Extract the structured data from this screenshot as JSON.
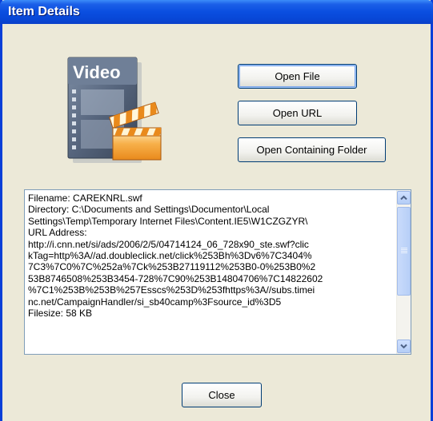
{
  "window": {
    "title": "Item Details"
  },
  "icon": {
    "label": "Video"
  },
  "buttons": {
    "open_file": "Open File",
    "open_url": "Open URL",
    "open_folder": "Open Containing Folder",
    "close": "Close"
  },
  "details": {
    "lines": [
      "Filename: CAREKNRL.swf",
      "Directory: C:\\Documents and Settings\\Documentor\\Local",
      "Settings\\Temp\\Temporary Internet Files\\Content.IE5\\W1CZGZYR\\",
      "URL Address:",
      "http://i.cnn.net/si/ads/2006/2/5/04714124_06_728x90_ste.swf?clic",
      "kTag=http%3A//ad.doubleclick.net/click%253Bh%3Dv6%7C3404%",
      "7C3%7C0%7C%252a%7Ck%253B27119112%253B0-0%253B0%2",
      "53B8746508%253B3454-728%7C90%253B14804706%7C14822602",
      "%7C1%253B%253B%257Esscs%253D%253fhttps%3A//subs.timei",
      "nc.net/CampaignHandler/si_sb40camp%3Fsource_id%3D5",
      "Filesize: 58 KB"
    ]
  },
  "colors": {
    "title_bar": "#0a4ee0",
    "window_bg": "#ece9d8",
    "button_border": "#003c74"
  }
}
